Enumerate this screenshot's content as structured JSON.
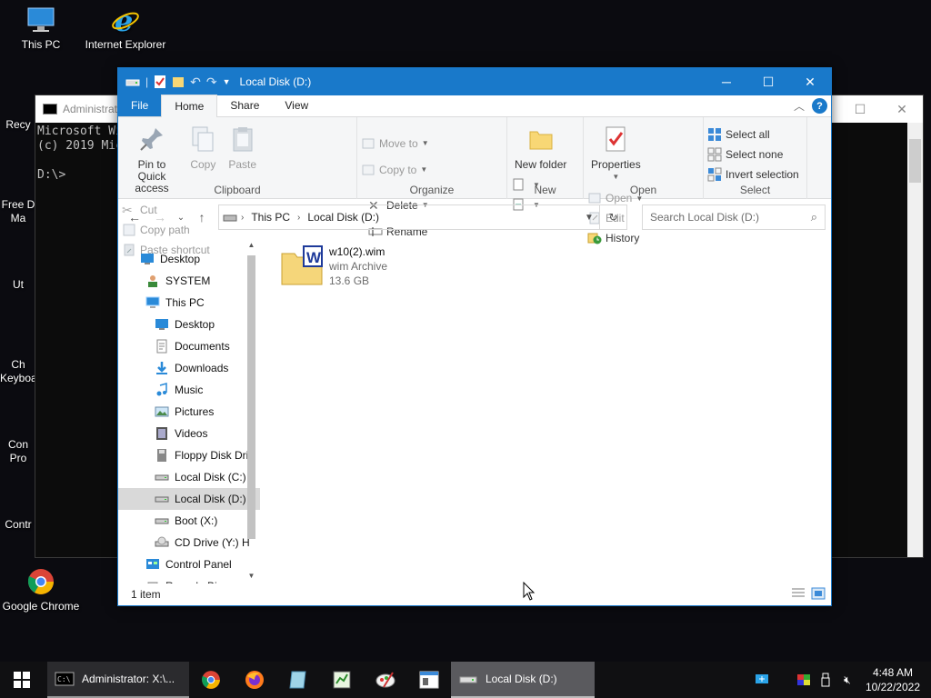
{
  "desktop": {
    "icons": [
      {
        "label": "This PC"
      },
      {
        "label": "Internet Explorer"
      },
      {
        "label": "Google Chrome"
      }
    ],
    "partial_labels": [
      "Recy",
      "Free D",
      "Ma",
      "Ut",
      "Ch",
      "Keyboa",
      "Con",
      "Pro",
      "Contr"
    ]
  },
  "console": {
    "title": "Administrat",
    "lines": [
      "Microsoft Wi",
      "(c) 2019 Mic",
      "",
      "D:\\>"
    ]
  },
  "explorer": {
    "title": "Local Disk (D:)",
    "tabs": [
      {
        "label": "File"
      },
      {
        "label": "Home"
      },
      {
        "label": "Share"
      },
      {
        "label": "View"
      }
    ],
    "ribbon": {
      "clipboard": {
        "label": "Clipboard",
        "pin": "Pin to Quick access",
        "copy": "Copy",
        "paste": "Paste",
        "cut": "Cut",
        "copy_path": "Copy path",
        "paste_shortcut": "Paste shortcut"
      },
      "organize": {
        "label": "Organize",
        "move_to": "Move to",
        "copy_to": "Copy to",
        "delete": "Delete",
        "rename": "Rename"
      },
      "new": {
        "label": "New",
        "new_folder": "New folder"
      },
      "open": {
        "label": "Open",
        "properties": "Properties",
        "open": "Open",
        "edit": "Edit",
        "history": "History"
      },
      "select": {
        "label": "Select",
        "select_all": "Select all",
        "select_none": "Select none",
        "invert": "Invert selection"
      }
    },
    "address": {
      "crumbs": [
        "This PC",
        "Local Disk (D:)"
      ]
    },
    "search": {
      "placeholder": "Search Local Disk (D:)"
    },
    "nav": [
      {
        "label": "Desktop",
        "indent": 0,
        "icon": "desktop-icon"
      },
      {
        "label": "SYSTEM",
        "indent": 1,
        "icon": "user-icon"
      },
      {
        "label": "This PC",
        "indent": 1,
        "icon": "computer-icon"
      },
      {
        "label": "Desktop",
        "indent": 2,
        "icon": "desktop-icon"
      },
      {
        "label": "Documents",
        "indent": 2,
        "icon": "documents-icon"
      },
      {
        "label": "Downloads",
        "indent": 2,
        "icon": "downloads-icon"
      },
      {
        "label": "Music",
        "indent": 2,
        "icon": "music-icon"
      },
      {
        "label": "Pictures",
        "indent": 2,
        "icon": "pictures-icon"
      },
      {
        "label": "Videos",
        "indent": 2,
        "icon": "videos-icon"
      },
      {
        "label": "Floppy Disk Dri",
        "indent": 2,
        "icon": "floppy-icon"
      },
      {
        "label": "Local Disk (C:)",
        "indent": 2,
        "icon": "drive-icon"
      },
      {
        "label": "Local Disk (D:)",
        "indent": 2,
        "icon": "drive-icon",
        "selected": true
      },
      {
        "label": "Boot (X:)",
        "indent": 2,
        "icon": "drive-icon"
      },
      {
        "label": "CD Drive (Y:) H",
        "indent": 2,
        "icon": "cd-icon"
      },
      {
        "label": "Control Panel",
        "indent": 1,
        "icon": "control-panel-icon"
      },
      {
        "label": "Recycle Bin",
        "indent": 1,
        "icon": "recycle-bin-icon"
      }
    ],
    "files": [
      {
        "name": "w10(2).wim",
        "type": "wim Archive",
        "size": "13.6 GB"
      }
    ],
    "status": "1 item"
  },
  "taskbar": {
    "cmd_label": "Administrator: X:\\...",
    "explorer_label": "Local Disk (D:)",
    "time": "4:48 AM",
    "date": "10/22/2022"
  },
  "colors": {
    "accent": "#1979ca",
    "taskbar": "#101012"
  }
}
